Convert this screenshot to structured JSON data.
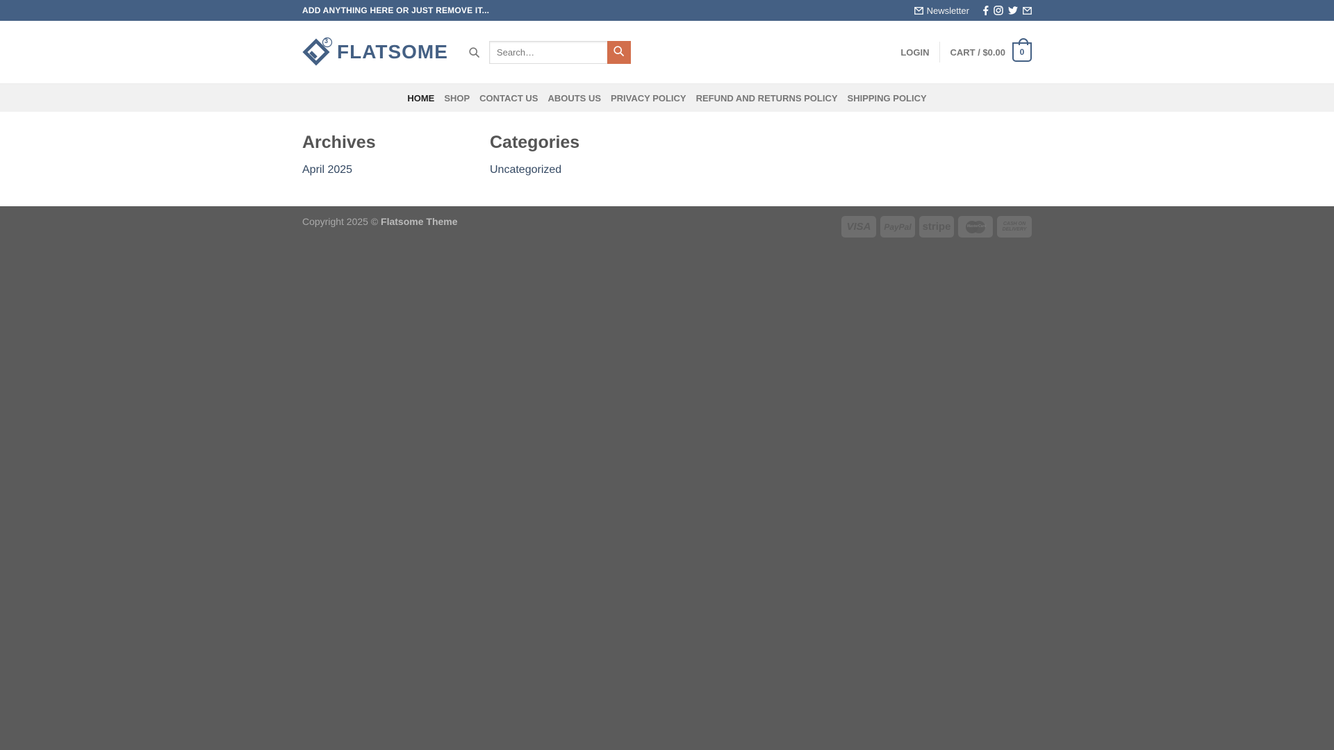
{
  "topbar": {
    "message": "ADD ANYTHING HERE OR JUST REMOVE IT...",
    "newsletter_label": "Newsletter",
    "social_icons": [
      "facebook-icon",
      "instagram-icon",
      "twitter-icon",
      "email-icon"
    ]
  },
  "header": {
    "logo_text": "FLATSOME",
    "logo_badge": "3",
    "search_placeholder": "Search…",
    "login_label": "LOGIN",
    "cart_label": "CART / $0.00",
    "cart_count": "0"
  },
  "nav": {
    "items": [
      {
        "label": "HOME",
        "active": true
      },
      {
        "label": "SHOP"
      },
      {
        "label": "CONTACT US"
      },
      {
        "label": "ABOUTS US"
      },
      {
        "label": "PRIVACY POLICY"
      },
      {
        "label": "REFUND AND RETURNS POLICY"
      },
      {
        "label": "SHIPPING POLICY"
      }
    ]
  },
  "widgets": {
    "archives": {
      "title": "Archives",
      "items": [
        "April 2025"
      ]
    },
    "categories": {
      "title": "Categories",
      "items": [
        "Uncategorized"
      ]
    }
  },
  "footer": {
    "copyright_prefix": "Copyright 2025 ©",
    "copyright_brand": "Flatsome Theme",
    "payments": [
      {
        "label": "VISA"
      },
      {
        "label": "PayPal"
      },
      {
        "label": "stripe"
      },
      {
        "label": "MasterCard"
      },
      {
        "label": "CASH ON DELIVERY"
      }
    ]
  },
  "colors": {
    "primary": "#446084",
    "accent": "#d26e4b",
    "footer_bg": "#5b5b5b"
  }
}
